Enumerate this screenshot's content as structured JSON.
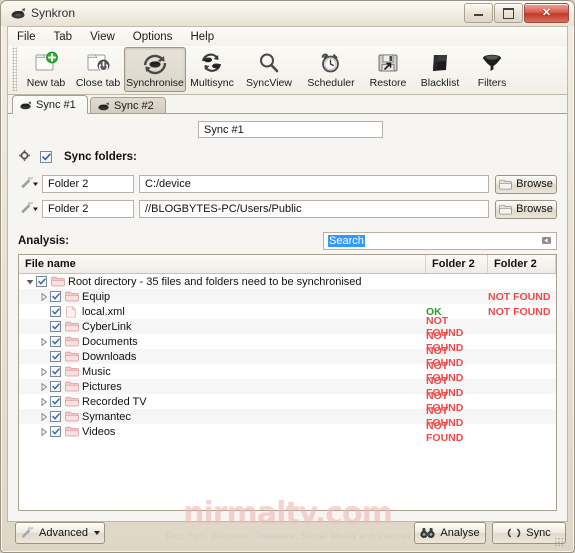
{
  "window": {
    "title": "Synkron",
    "icon": "synkron-app-icon",
    "controls": {
      "minimize": "minimize-button",
      "maximize": "maximize-button",
      "close": "close-button"
    }
  },
  "menubar": {
    "items": [
      {
        "label": "File"
      },
      {
        "label": "Tab"
      },
      {
        "label": "View"
      },
      {
        "label": "Options"
      },
      {
        "label": "Help"
      }
    ]
  },
  "toolbar": {
    "buttons": [
      {
        "label": "New tab",
        "icon": "new-tab-icon",
        "active": false
      },
      {
        "label": "Close tab",
        "icon": "close-tab-icon",
        "active": false
      },
      {
        "label": "Synchronise",
        "icon": "synchronise-icon",
        "active": true
      },
      {
        "label": "Multisync",
        "icon": "multisync-icon",
        "active": false
      },
      {
        "label": "SyncView",
        "icon": "syncview-icon",
        "active": false
      },
      {
        "label": "Scheduler",
        "icon": "scheduler-icon",
        "active": false
      },
      {
        "label": "Restore",
        "icon": "restore-icon",
        "active": false
      },
      {
        "label": "Blacklist",
        "icon": "blacklist-icon",
        "active": false
      },
      {
        "label": "Filters",
        "icon": "filters-icon",
        "active": false
      }
    ]
  },
  "tabs": [
    {
      "label": "Sync #1",
      "selected": true
    },
    {
      "label": "Sync #2",
      "selected": false
    }
  ],
  "sync_tab": {
    "name_field": {
      "value": "Sync #1"
    },
    "sync_folders": {
      "label": "Sync folders:",
      "enabled": true,
      "add_icon": "add-folder-icon",
      "rows": [
        {
          "icon": "wrench-dropdown-icon",
          "name": "Folder 2",
          "path": "C:/device",
          "browse_label": "Browse"
        },
        {
          "icon": "wrench-dropdown-icon",
          "name": "Folder 2",
          "path": "//BLOGBYTES-PC/Users/Public",
          "browse_label": "Browse"
        }
      ]
    },
    "analysis": {
      "label": "Analysis:",
      "search_value": "Search",
      "search_selected": true,
      "clear_icon": "clear-search-icon"
    },
    "tree": {
      "columns": [
        "File name",
        "Folder 2",
        "Folder 2"
      ],
      "rows": [
        {
          "indent": 0,
          "expander": "expanded",
          "checked": true,
          "icon": "folder-icon",
          "label": "Root directory - 35 files and folders need to be synchronised",
          "col1": "",
          "col2": ""
        },
        {
          "indent": 1,
          "expander": "collapsed",
          "checked": true,
          "icon": "folder-icon",
          "label": "Equip",
          "col1": "",
          "col2": "NOT FOUND"
        },
        {
          "indent": 1,
          "expander": "none",
          "checked": true,
          "icon": "file-icon",
          "label": "local.xml",
          "col1": "OK",
          "col2": "NOT FOUND"
        },
        {
          "indent": 1,
          "expander": "none",
          "checked": true,
          "icon": "folder-icon",
          "label": "CyberLink",
          "col1": "NOT FOUND",
          "col2": ""
        },
        {
          "indent": 1,
          "expander": "collapsed",
          "checked": true,
          "icon": "folder-icon",
          "label": "Documents",
          "col1": "NOT FOUND",
          "col2": ""
        },
        {
          "indent": 1,
          "expander": "none",
          "checked": true,
          "icon": "folder-icon",
          "label": "Downloads",
          "col1": "NOT FOUND",
          "col2": ""
        },
        {
          "indent": 1,
          "expander": "collapsed",
          "checked": true,
          "icon": "folder-icon",
          "label": "Music",
          "col1": "NOT FOUND",
          "col2": ""
        },
        {
          "indent": 1,
          "expander": "collapsed",
          "checked": true,
          "icon": "folder-icon",
          "label": "Pictures",
          "col1": "NOT FOUND",
          "col2": ""
        },
        {
          "indent": 1,
          "expander": "collapsed",
          "checked": true,
          "icon": "folder-icon",
          "label": "Recorded TV",
          "col1": "NOT FOUND",
          "col2": ""
        },
        {
          "indent": 1,
          "expander": "collapsed",
          "checked": true,
          "icon": "folder-icon",
          "label": "Symantec",
          "col1": "NOT FOUND",
          "col2": ""
        },
        {
          "indent": 1,
          "expander": "collapsed",
          "checked": true,
          "icon": "folder-icon",
          "label": "Videos",
          "col1": "NOT FOUND",
          "col2": ""
        }
      ]
    }
  },
  "bottom_bar": {
    "advanced": {
      "label": "Advanced",
      "icon": "wrench-icon",
      "has_caret": true
    },
    "analyse": {
      "label": "Analyse",
      "icon": "binoculars-icon"
    },
    "sync": {
      "label": "Sync",
      "icon": "sync-arrows-icon"
    }
  },
  "watermark": {
    "primary": "nirmaltv.com",
    "secondary": "Tech Tips, Windows, Freeware, Social Media and Internet"
  },
  "colors": {
    "not_found": "#f24a4a",
    "ok": "#2e9b2e",
    "selection": "#3399ff",
    "window_chrome": "#ece7da"
  }
}
